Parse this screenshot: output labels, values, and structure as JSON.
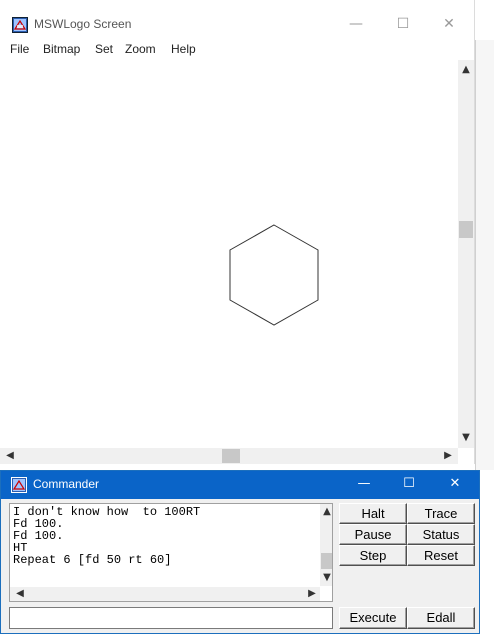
{
  "main_window": {
    "title": "MSWLogo Screen",
    "controls": {
      "minimize": "—",
      "maximize": "☐",
      "close": "✕"
    },
    "menu": [
      "File",
      "Bitmap",
      "Set",
      "Zoom",
      "Help"
    ],
    "canvas": {
      "drawing": "hexagon",
      "stroke_color": "#333333"
    }
  },
  "commander": {
    "title": "Commander",
    "controls": {
      "minimize": "—",
      "maximize": "☐",
      "close": "✕"
    },
    "history": [
      "I don't know how  to 100RT",
      "Fd 100.",
      "Fd 100.",
      "HT",
      "Repeat 6 [fd 50 rt 60]"
    ],
    "input_value": "",
    "buttons": {
      "halt": "Halt",
      "trace": "Trace",
      "pause": "Pause",
      "status": "Status",
      "step": "Step",
      "reset": "Reset",
      "execute": "Execute",
      "edall": "Edall"
    }
  },
  "colors": {
    "commander_title_bg": "#0a64c8",
    "window_bg": "#ffffff",
    "panel_bg": "#f0f0f0"
  }
}
